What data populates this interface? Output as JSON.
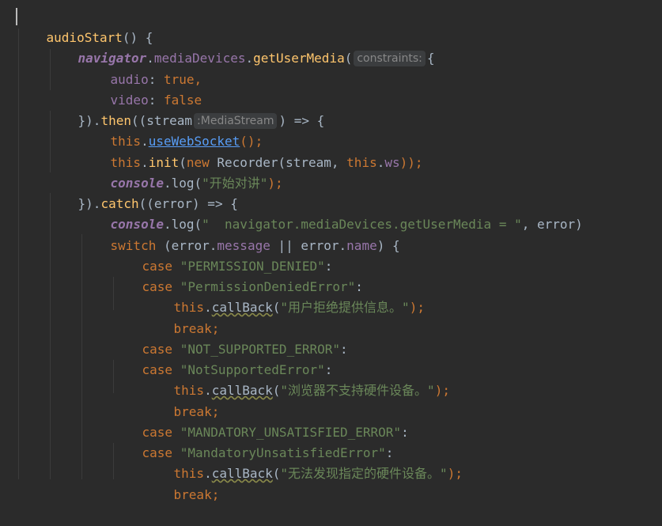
{
  "editor": {
    "hints": {
      "constraints": "constraints:",
      "stream_type": ":MediaStream"
    },
    "lines": [
      {
        "tokens": [
          "audioStart",
          "() {"
        ]
      },
      {
        "tokens": [
          "navigator",
          ".",
          "mediaDevices",
          ".",
          "getUserMedia",
          "(",
          "{"
        ]
      },
      {
        "tokens": [
          "audio",
          ": ",
          "true",
          ","
        ]
      },
      {
        "tokens": [
          "video",
          ": ",
          "false"
        ]
      },
      {
        "tokens": [
          "}).",
          "then",
          "((stream",
          ") => {"
        ]
      },
      {
        "tokens": [
          "this",
          ".",
          "useWebSocket",
          "();"
        ]
      },
      {
        "tokens": [
          "this",
          ".",
          "init",
          "(",
          "new ",
          "Recorder(stream, ",
          "this",
          ".",
          "ws",
          "));"
        ]
      },
      {
        "tokens": [
          "console",
          ".log(",
          "\"开始对讲\"",
          ");"
        ]
      },
      {
        "tokens": [
          "}).",
          "catch",
          "((error) => {"
        ]
      },
      {
        "tokens": [
          "console",
          ".log(",
          "\"  navigator.mediaDevices.getUserMedia = \"",
          ", error)"
        ]
      },
      {
        "tokens": [
          "switch ",
          "(error.",
          "message",
          " || error.",
          "name",
          ") {"
        ]
      },
      {
        "tokens": [
          "case ",
          "\"PERMISSION_DENIED\"",
          ":"
        ]
      },
      {
        "tokens": [
          "case ",
          "\"PermissionDeniedError\"",
          ":"
        ]
      },
      {
        "tokens": [
          "this",
          ".",
          "callBack",
          "(",
          "\"用户拒绝提供信息。\"",
          ");"
        ]
      },
      {
        "tokens": [
          "break",
          ";"
        ]
      },
      {
        "tokens": [
          "case ",
          "\"NOT_SUPPORTED_ERROR\"",
          ":"
        ]
      },
      {
        "tokens": [
          "case ",
          "\"NotSupportedError\"",
          ":"
        ]
      },
      {
        "tokens": [
          "this",
          ".",
          "callBack",
          "(",
          "\"浏览器不支持硬件设备。\"",
          ");"
        ]
      },
      {
        "tokens": [
          "break",
          ";"
        ]
      },
      {
        "tokens": [
          "case ",
          "\"MANDATORY_UNSATISFIED_ERROR\"",
          ":"
        ]
      },
      {
        "tokens": [
          "case ",
          "\"MandatoryUnsatisfiedError\"",
          ":"
        ]
      },
      {
        "tokens": [
          "this",
          ".",
          "callBack",
          "(",
          "\"无法发现指定的硬件设备。\"",
          ");"
        ]
      },
      {
        "tokens": [
          "break",
          ";"
        ]
      }
    ]
  },
  "colors": {
    "background": "#2b2b2b",
    "keyword": "#cc7832",
    "function": "#ffc66d",
    "property": "#9876aa",
    "string": "#6a8759",
    "text": "#a9b7c6",
    "link": "#589df6"
  }
}
